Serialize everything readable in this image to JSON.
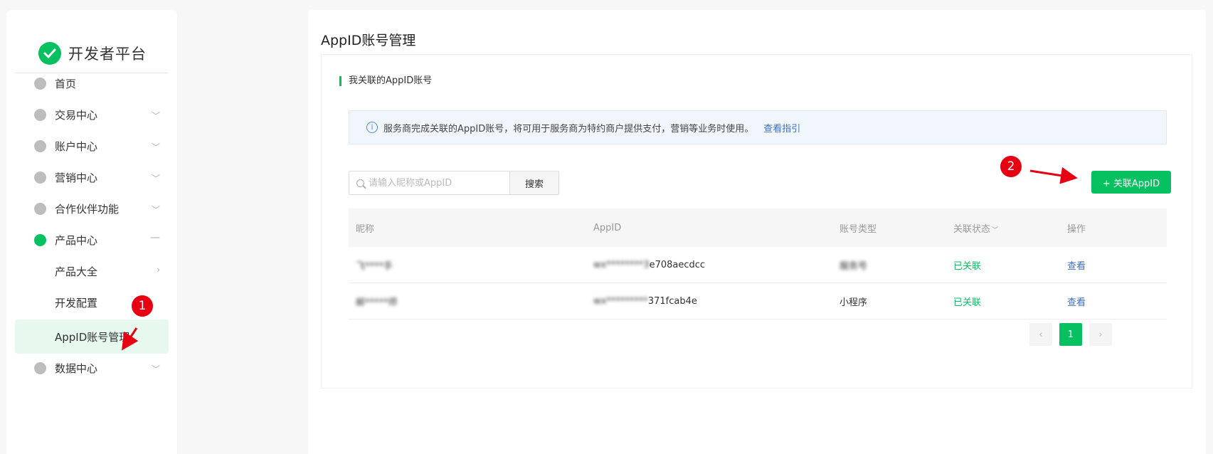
{
  "sidebar": {
    "brand": "开发者平台",
    "items": [
      {
        "label": "首页",
        "icon": "circle-icon",
        "expandable": false,
        "state": "default"
      },
      {
        "label": "交易中心",
        "icon": "circle-icon",
        "expandable": true,
        "state": "collapsed"
      },
      {
        "label": "账户中心",
        "icon": "circle-icon",
        "expandable": true,
        "state": "collapsed"
      },
      {
        "label": "营销中心",
        "icon": "circle-icon",
        "expandable": true,
        "state": "collapsed"
      },
      {
        "label": "合作伙伴功能",
        "icon": "circle-icon",
        "expandable": true,
        "state": "collapsed"
      },
      {
        "label": "产品中心",
        "icon": "circle-icon",
        "expandable": true,
        "state": "expanded"
      },
      {
        "label": "数据中心",
        "icon": "circle-icon",
        "expandable": true,
        "state": "collapsed"
      }
    ],
    "sub_items": [
      {
        "label": "产品大全",
        "has_arrow": true
      },
      {
        "label": "开发配置",
        "has_arrow": false
      },
      {
        "label": "AppID账号管理",
        "active": true
      }
    ]
  },
  "main": {
    "title": "AppID账号管理",
    "section_title": "我关联的AppID账号",
    "info": {
      "text": "服务商完成关联的AppID账号，将可用于服务商为特约商户提供支付，营销等业务时使用。",
      "link": "查看指引"
    },
    "search": {
      "placeholder": "请输入昵称或AppID",
      "button": "搜索"
    },
    "add_button": "+ 关联AppID",
    "table": {
      "headers": [
        "昵称",
        "AppID",
        "账号类型",
        "关联状态",
        "操作"
      ],
      "rows": [
        {
          "nickname": "飞****手",
          "appid_blur": "wx********3",
          "appid_tail": "e708aecdcc",
          "type": "服务号",
          "type_blurred": true,
          "status": "已关联",
          "action": "查看"
        },
        {
          "nickname": "邮*****师",
          "appid_blur": "wx*********",
          "appid_tail": "371fcab4e",
          "type": "小程序",
          "type_blurred": false,
          "status": "已关联",
          "action": "查看"
        }
      ]
    },
    "pagination": {
      "current": "1",
      "prev": "‹",
      "next": "›"
    }
  },
  "annotations": [
    {
      "label": "1"
    },
    {
      "label": "2"
    }
  ],
  "colors": {
    "primary": "#07c160",
    "link": "#3e6fbf",
    "annotation": "#e60012"
  }
}
